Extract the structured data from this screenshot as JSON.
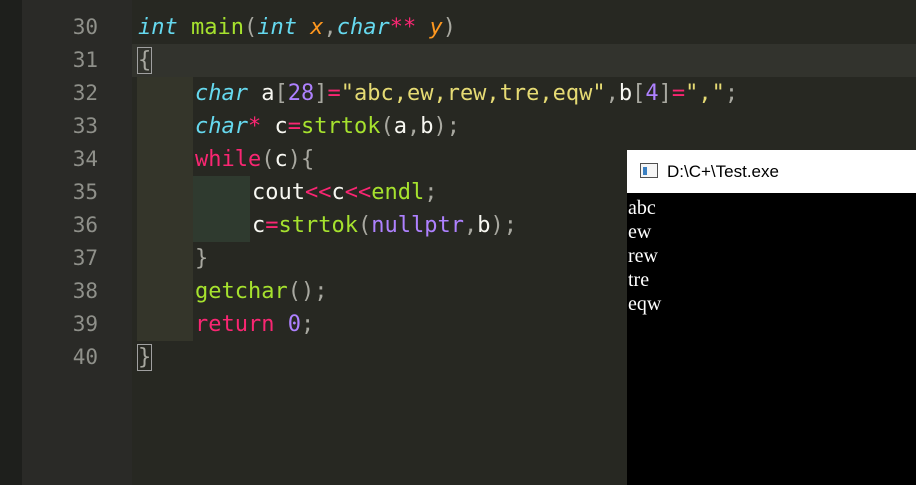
{
  "editor": {
    "line_numbers": [
      "30",
      "31",
      "32",
      "33",
      "34",
      "35",
      "36",
      "37",
      "38",
      "39",
      "40"
    ],
    "tokens": {
      "int": "int",
      "main": "main",
      "x": "x",
      "char": "char",
      "stars": "**",
      "y": "y",
      "a": "a",
      "n28": "28",
      "str_main": "\"abc,ew,rew,tre,eqw\"",
      "b": "b",
      "n4": "4",
      "str_comma": "\",\"",
      "star": "*",
      "c": "c",
      "strtok": "strtok",
      "while": "while",
      "cout": "cout",
      "shl": "<<",
      "endl": "endl",
      "nullptr": "nullptr",
      "getchar": "getchar",
      "return": "return",
      "zero": "0"
    }
  },
  "console": {
    "title": "D:\\C+\\Test.exe",
    "output": [
      "abc",
      "ew",
      "rew",
      "tre",
      "eqw"
    ]
  }
}
